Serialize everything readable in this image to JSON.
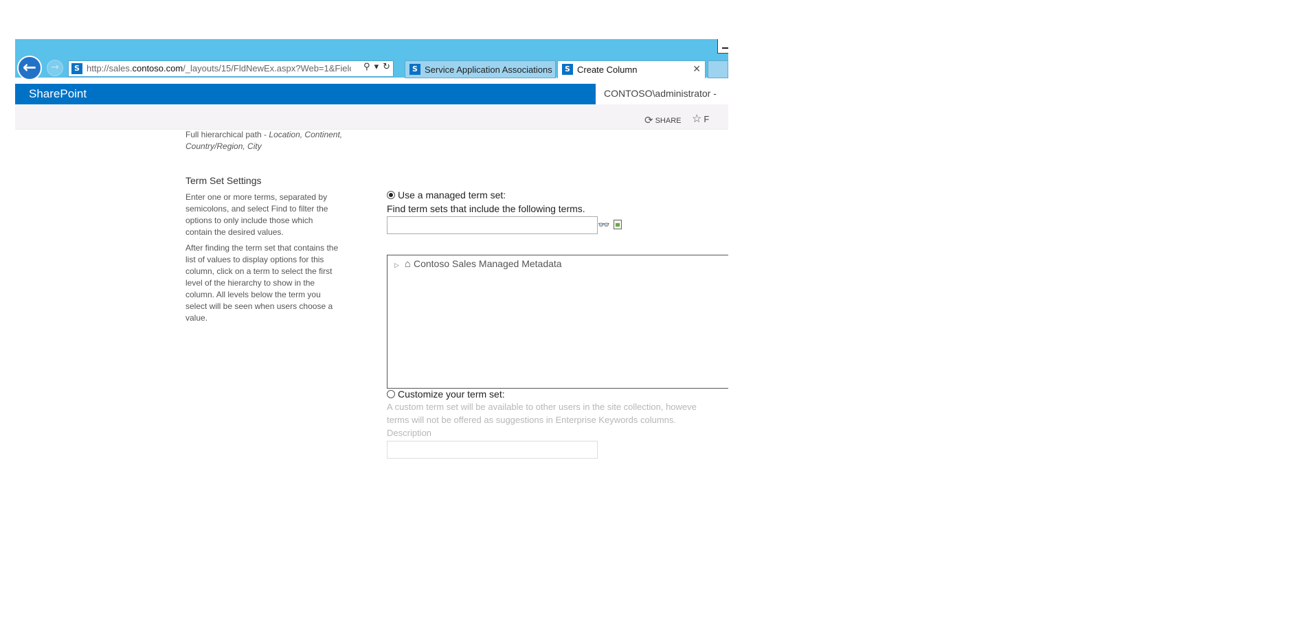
{
  "browser": {
    "url_prefix": "http://sales.",
    "url_domain": "contoso.com",
    "url_suffix": "/_layouts/15/FldNewEx.aspx?Web=1&Fielc",
    "favicon_text": "S",
    "tabs": [
      {
        "label": "Service Application Associations",
        "active": false
      },
      {
        "label": "Create Column",
        "active": true
      }
    ]
  },
  "suitebar": {
    "brand": "SharePoint",
    "user": "CONTOSO\\administrator -"
  },
  "ribbon": {
    "share_label": "SHARE",
    "follow_label": "F"
  },
  "display_format": {
    "line1_plain": "Full hierarchical path - ",
    "line1_italic": "Location, Continent,",
    "line2_italic": "Country/Region, City"
  },
  "term_set_settings": {
    "title": "Term Set Settings",
    "desc1": [
      "Enter one or more terms, separated by",
      "semicolons, and select Find to filter the",
      "options to only include those which",
      "contain the desired values."
    ],
    "desc2": [
      "After finding the term set that contains the",
      "list of values to display options for this",
      "column, click on a term to select the first",
      "level of the hierarchy to show in the",
      "column. All levels below the term you",
      "select will be seen when users choose a",
      "value."
    ],
    "managed_label": "Use a managed term set:",
    "find_label": "Find term sets that include the following terms.",
    "find_value": "",
    "tree_root": "Contoso Sales Managed Metadata",
    "customize_label": "Customize your term set:",
    "customize_desc1": "A custom term set will be available to other users in the site collection, howeve",
    "customize_desc2": "terms will not be offered as suggestions in Enterprise Keywords columns.",
    "description_label": "Description",
    "description_value": ""
  }
}
